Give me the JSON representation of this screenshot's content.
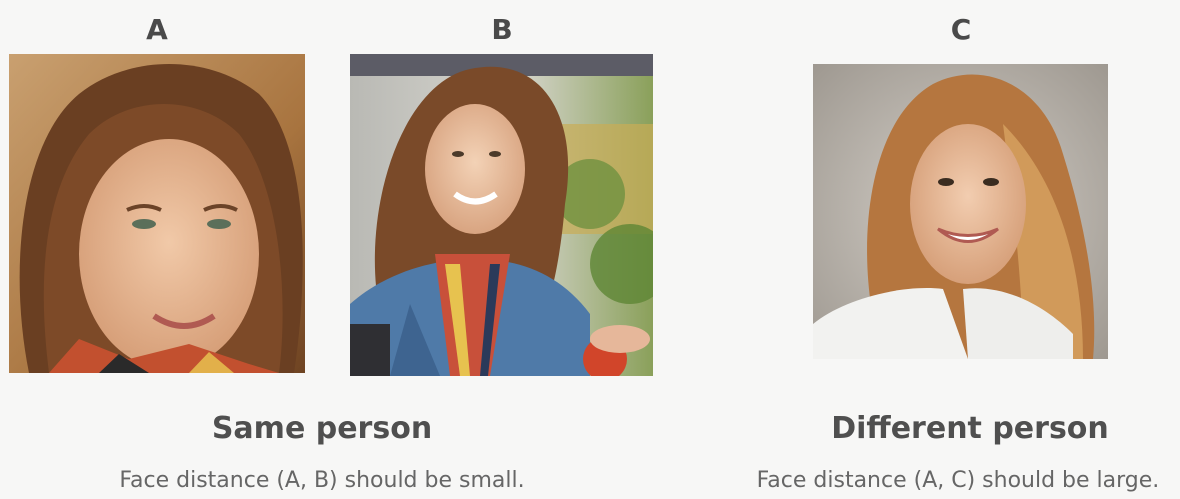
{
  "labels": {
    "a": "A",
    "b": "B",
    "c": "C"
  },
  "left_group": {
    "title": "Same person",
    "subtitle": "Face distance (A, B) should be small."
  },
  "right_group": {
    "title": "Different person",
    "subtitle": "Face distance (A, C) should be large."
  },
  "colors": {
    "background": "#f7f7f6",
    "heading": "#4f4f4f",
    "body_text": "#666666"
  }
}
